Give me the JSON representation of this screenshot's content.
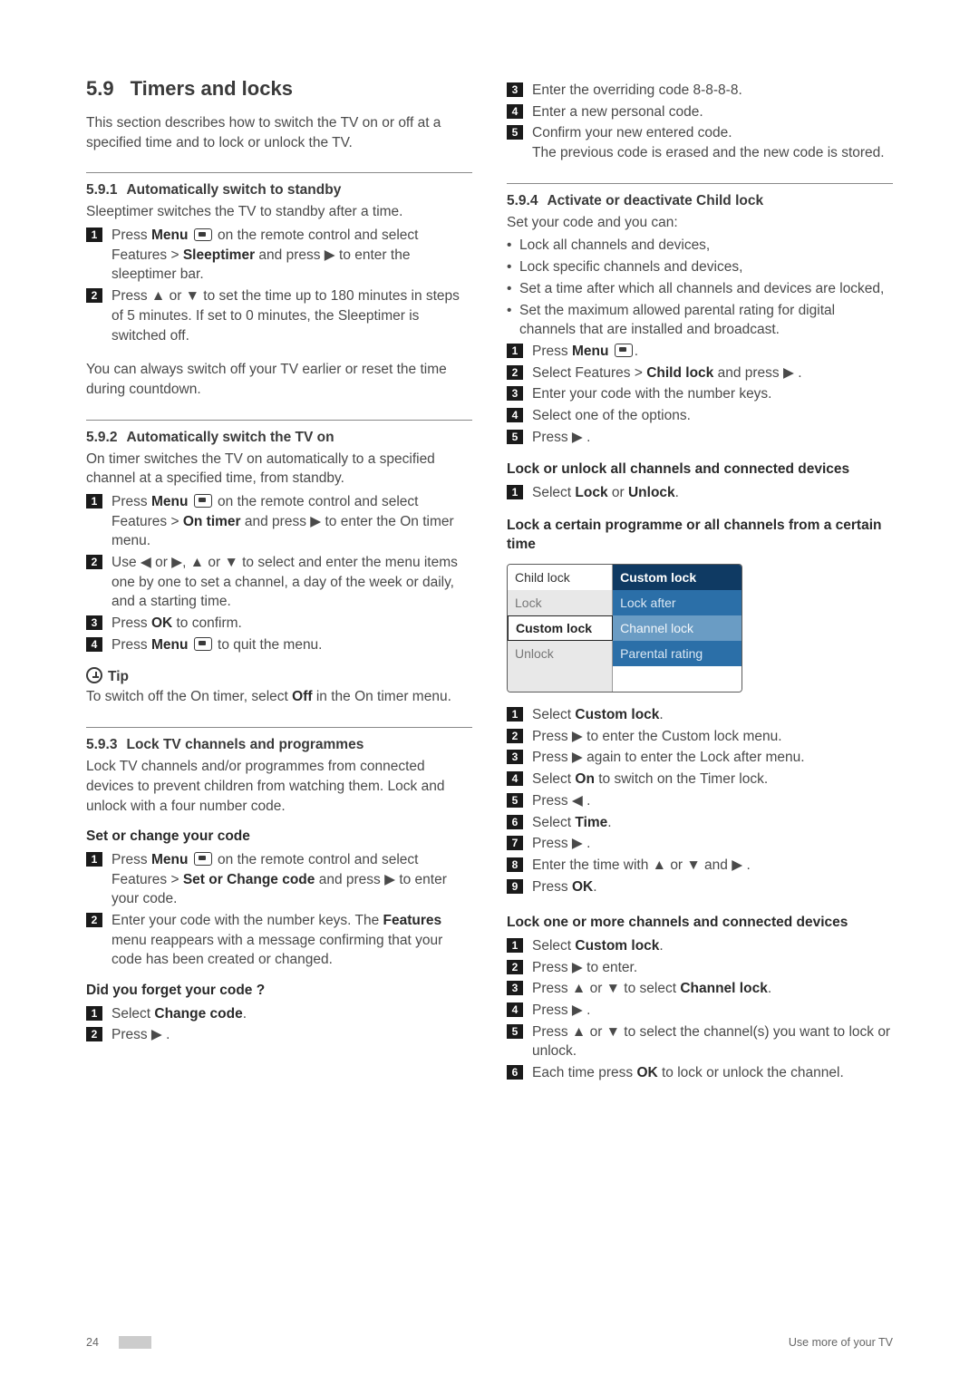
{
  "section": {
    "num": "5.9",
    "title": "Timers and locks"
  },
  "intro": "This section describes how to switch the TV on or off at a specified time and to lock or unlock the TV.",
  "s591": {
    "num": "5.9.1",
    "title": "Automatically switch to standby",
    "desc": "Sleeptimer switches the TV to standby after a time.",
    "step1a": "Press ",
    "step1b": "Menu",
    "step1c": " on the remote control and select Features > ",
    "step1d": "Sleeptimer",
    "step1e": " and press ▶ to enter the sleeptimer bar.",
    "step2": "Press ▲ or ▼ to set the time up to 180 minutes in steps of 5 minutes. If set to 0 minutes, the Sleeptimer is switched off.",
    "note": "You can always switch off your TV earlier or reset the time during countdown."
  },
  "s592": {
    "num": "5.9.2",
    "title": "Automatically switch the TV on",
    "desc": "On timer switches the TV on automatically to a specified channel at a specified time, from standby.",
    "step1a": "Press ",
    "step1b": "Menu",
    "step1c": " on the remote control and select Features > ",
    "step1d": "On timer",
    "step1e": " and press ▶ to enter the On timer menu.",
    "step2": "Use ◀ or ▶, ▲ or ▼ to select and enter the menu items one by one to set a channel, a day of the week or daily, and a starting time.",
    "step3a": "Press ",
    "step3b": "OK",
    "step3c": " to confirm.",
    "step4a": "Press ",
    "step4b": "Menu",
    "step4c": " to quit the menu."
  },
  "tip": {
    "label": "Tip",
    "text_a": "To switch off the On timer, select ",
    "text_b": "Off",
    "text_c": " in the On timer menu."
  },
  "s593": {
    "num": "5.9.3",
    "title": "Lock TV channels and programmes",
    "desc": "Lock TV channels and/or programmes from connected devices to prevent children from watching them. Lock and unlock with a four number code.",
    "setHead": "Set or change your code",
    "set1a": "Press ",
    "set1b": "Menu",
    "set1c": " on the remote control and select Features > ",
    "set1d": "Set or Change code",
    "set1e": " and press ▶ to enter your code.",
    "set2a": "Enter your code with the number keys. The ",
    "set2b": "Features",
    "set2c": " menu reappears with a message confirming that your code has been created or changed.",
    "forgotHead": "Did you forget your code ?",
    "forgot1a": "Select ",
    "forgot1b": "Change code",
    "forgot1c": ".",
    "forgot2": "Press ▶ ."
  },
  "rightTop": {
    "s3": "Enter the overriding code 8-8-8-8.",
    "s4": "Enter a new personal code.",
    "s5": "Confirm your new entered code.",
    "s5b": "The previous code is erased and the new code is stored."
  },
  "s594": {
    "num": "5.9.4",
    "title": "Activate or deactivate Child lock",
    "desc": "Set your code and you can:",
    "b1": "Lock all channels and devices,",
    "b2": "Lock specific channels and devices,",
    "b3": "Set a time after which all channels and devices are locked,",
    "b4": "Set the maximum allowed parental rating for digital channels that are installed and broadcast.",
    "s1a": "Press ",
    "s1b": "Menu",
    "s1c": ".",
    "s2a": "Select Features > ",
    "s2b": "Child lock",
    "s2c": " and press ▶ .",
    "s3": "Enter your code with the number keys.",
    "s4": "Select one of the options.",
    "s5": "Press ▶ .",
    "lockAllHead": "Lock or unlock all channels and connected devices",
    "lockAll1a": "Select ",
    "lockAll1b": "Lock",
    "lockAll1c": " or ",
    "lockAll1d": "Unlock",
    "lockAll1e": ".",
    "lockCertHead": "Lock a certain programme or all channels from a certain time"
  },
  "menu": {
    "l1": "Child lock",
    "r1": "Custom lock",
    "l2": "Lock",
    "r2": "Lock after",
    "l3": "Custom lock",
    "r3": "Channel lock",
    "l4": "Unlock",
    "r4": "Parental rating"
  },
  "custom": {
    "s1a": "Select ",
    "s1b": "Custom lock",
    "s1c": ".",
    "s2": "Press ▶ to enter the Custom lock menu.",
    "s3": "Press ▶ again to enter the Lock after menu.",
    "s4a": "Select ",
    "s4b": "On",
    "s4c": " to switch on the Timer lock.",
    "s5": "Press ◀ .",
    "s6a": "Select ",
    "s6b": "Time",
    "s6c": ".",
    "s7": "Press ▶ .",
    "s8": "Enter the time with ▲ or ▼ and ▶ .",
    "s9a": "Press ",
    "s9b": "OK",
    "s9c": "."
  },
  "lockOne": {
    "head": "Lock one or more channels and connected devices",
    "s1a": "Select ",
    "s1b": "Custom lock",
    "s1c": ".",
    "s2": "Press ▶ to enter.",
    "s3a": "Press ▲ or ▼ to select ",
    "s3b": "Channel lock",
    "s3c": ".",
    "s4": "Press ▶ .",
    "s5": "Press ▲ or ▼ to select the channel(s) you want to lock or unlock.",
    "s6a": "Each time press ",
    "s6b": "OK",
    "s6c": " to lock or unlock the channel."
  },
  "footer": {
    "page": "24",
    "label": "Use more of your TV"
  }
}
